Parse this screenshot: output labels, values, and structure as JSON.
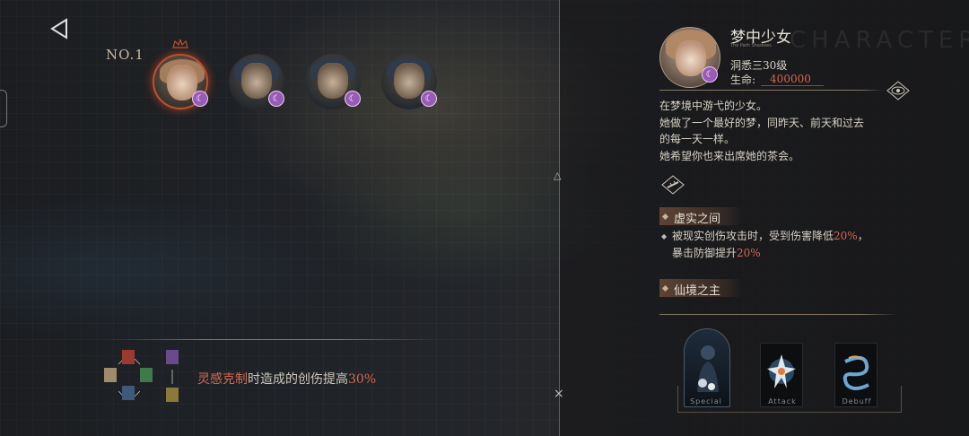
{
  "left_panel": {
    "rank_label": "NO.1",
    "team": [
      {
        "id": "slot-1",
        "active": true
      },
      {
        "id": "slot-2",
        "active": false
      },
      {
        "id": "slot-3",
        "active": false
      },
      {
        "id": "slot-4",
        "active": false
      }
    ],
    "counter": {
      "term": "灵感克制",
      "text": "时造成的创伤提高",
      "value": "30%"
    }
  },
  "character": {
    "name": "梦中少女",
    "subtitle": "The Path Shadows",
    "watermark": "CHARACTER·INF",
    "level": "洞悉三30级",
    "hp_label": "生命:",
    "hp_value": "400000",
    "description": [
      "在梦境中游弋的少女。",
      "她做了一个最好的梦，同昨天、前天和过去",
      "的每一天一样。",
      "她希望你也来出席她的茶会。"
    ],
    "skill1": {
      "title": "虚实之间",
      "line1_a": "被现实创伤攻击时，受到伤害降低",
      "line1_val": "20%",
      "line1_b": "，",
      "line2_a": "暴击防御提升",
      "line2_val": "20%"
    },
    "skill2": {
      "title": "仙境之主"
    },
    "cards": [
      {
        "label": "Special"
      },
      {
        "label": "Attack"
      },
      {
        "label": "Debuff"
      }
    ]
  },
  "colors": {
    "accent": "#d4684f",
    "moon_badge": "#9a5ab8"
  },
  "icons": [
    "back-triangle-icon",
    "crown-icon",
    "moon-icon",
    "eye-icon",
    "ruler-icon",
    "counter-wheel-icon",
    "close-icon"
  ]
}
